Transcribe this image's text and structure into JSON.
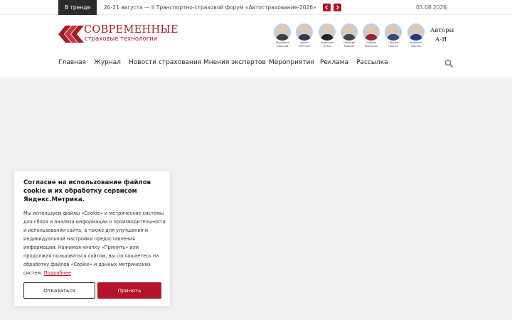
{
  "topbar": {
    "trend_label": "В тренде",
    "trend_text": "20-21 августа — II Транспортно-страховой форум «Автострахование-2026»",
    "prev_icon": "chevron-left-icon",
    "next_icon": "chevron-right-icon",
    "date": "03.08.2026",
    "separator": "|"
  },
  "logo": {
    "title": "СОВРЕМЕННЫЕ",
    "subtitle": "страховые технологии",
    "color": "#a51d2a"
  },
  "authors": [
    {
      "name_line1": "Журавлев",
      "name_line2": "Николай",
      "shirt": "#3a3f4a"
    },
    {
      "name_line1": "Ильин",
      "name_line2": "Евгений",
      "shirt": "#2e3a52"
    },
    {
      "name_line1": "Хрипкова",
      "name_line2": "Гузель",
      "shirt": "#222222"
    },
    {
      "name_line1": "Павлова",
      "name_line2": "Марина",
      "shirt": "#444444"
    },
    {
      "name_line1": "Копова",
      "name_line2": "Виктория",
      "shirt": "#8a2a2a"
    },
    {
      "name_line1": "Ситров",
      "name_line2": "Никита",
      "shirt": "#2f4a7a"
    },
    {
      "name_line1": "Доронин",
      "name_line2": "Виктор",
      "shirt": "#1f3c78"
    }
  ],
  "authors_az": {
    "line1": "Авторы",
    "line2": "А-Я"
  },
  "nav": [
    "Главная",
    "Журнал",
    "Новости страхования",
    "Мнения экспертов",
    "Мероприятия",
    "Реклама",
    "Рассылка"
  ],
  "search_icon": "search-icon",
  "cookie": {
    "title": "Согласие на использование файлов cookie и их обработку сервисом Яндекс.Метрика.",
    "text": "Мы используем файлы «Cookie» и метрические системы для сбора и анализа информации о производительности и использовании сайта, а также для улучшения и индивидуальной настройки предоставления информации. Нажимая кнопку «Принять» или продолжая пользоваться сайтом, вы соглашаетесь на обработку файлов «Cookie» и данных метрических систем.",
    "link": "Подробнее",
    "decline": "Отказаться",
    "accept": "Принять"
  },
  "colors": {
    "accent": "#b5122b",
    "dark": "#2b2b2b",
    "background": "#f1f1f3"
  }
}
